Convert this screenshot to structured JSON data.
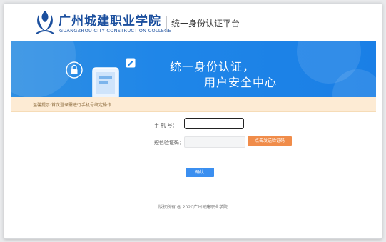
{
  "header": {
    "school_name_cn": "广州城建职业学院",
    "school_name_en": "GUANGZHOU CITY CONSTRUCTION COLLEGE",
    "platform_title": "统一身份认证平台"
  },
  "banner": {
    "line1": "统一身份认证，",
    "line2": "用户安全中心"
  },
  "notice": {
    "text": "温馨提示:首次登录需进行手机号绑定操作"
  },
  "form": {
    "phone_label": "手 机 号：",
    "phone_value": "",
    "code_label": "短信验证码：",
    "code_value": "",
    "send_code_label": "点击发送验证码",
    "confirm_label": "确认"
  },
  "footer": {
    "text": "版权所有 @ 2020广州城建职业学院"
  },
  "colors": {
    "brand_blue": "#1b4f9e",
    "banner_blue": "#1f86e8",
    "notice_bg": "#fdebd4",
    "send_button": "#f08c4a",
    "confirm_button": "#3b8ff0"
  },
  "icons": {
    "logo": "school-logo",
    "lock": "lock-icon",
    "phone": "phone-illustration",
    "edit": "edit-icon"
  }
}
